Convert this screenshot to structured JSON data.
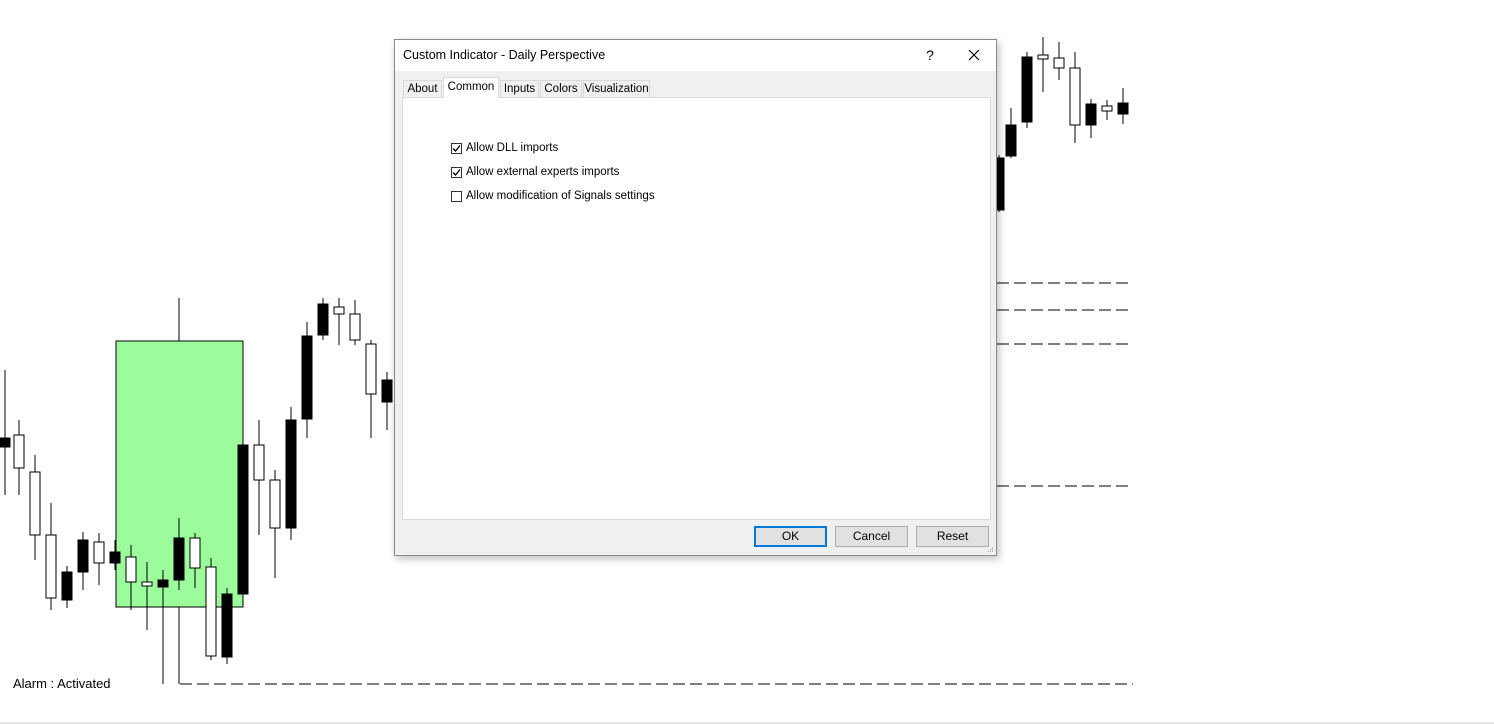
{
  "dialog": {
    "title": "Custom Indicator - Daily Perspective",
    "help_label": "?",
    "tabs": [
      {
        "label": "About",
        "active": false
      },
      {
        "label": "Common",
        "active": true
      },
      {
        "label": "Inputs",
        "active": false
      },
      {
        "label": "Colors",
        "active": false
      },
      {
        "label": "Visualization",
        "active": false
      }
    ],
    "options": [
      {
        "label": "Allow DLL imports",
        "checked": true
      },
      {
        "label": "Allow external experts imports",
        "checked": true
      },
      {
        "label": "Allow modification of Signals settings",
        "checked": false
      }
    ],
    "buttons": {
      "ok": "OK",
      "cancel": "Cancel",
      "reset": "Reset"
    }
  },
  "chart": {
    "status_text": "Alarm : Activated",
    "colors": {
      "box_fill": "#9cfc9c",
      "bull_body": "#ffffff",
      "bear_body": "#000000",
      "accent": "#0078d7"
    }
  }
}
